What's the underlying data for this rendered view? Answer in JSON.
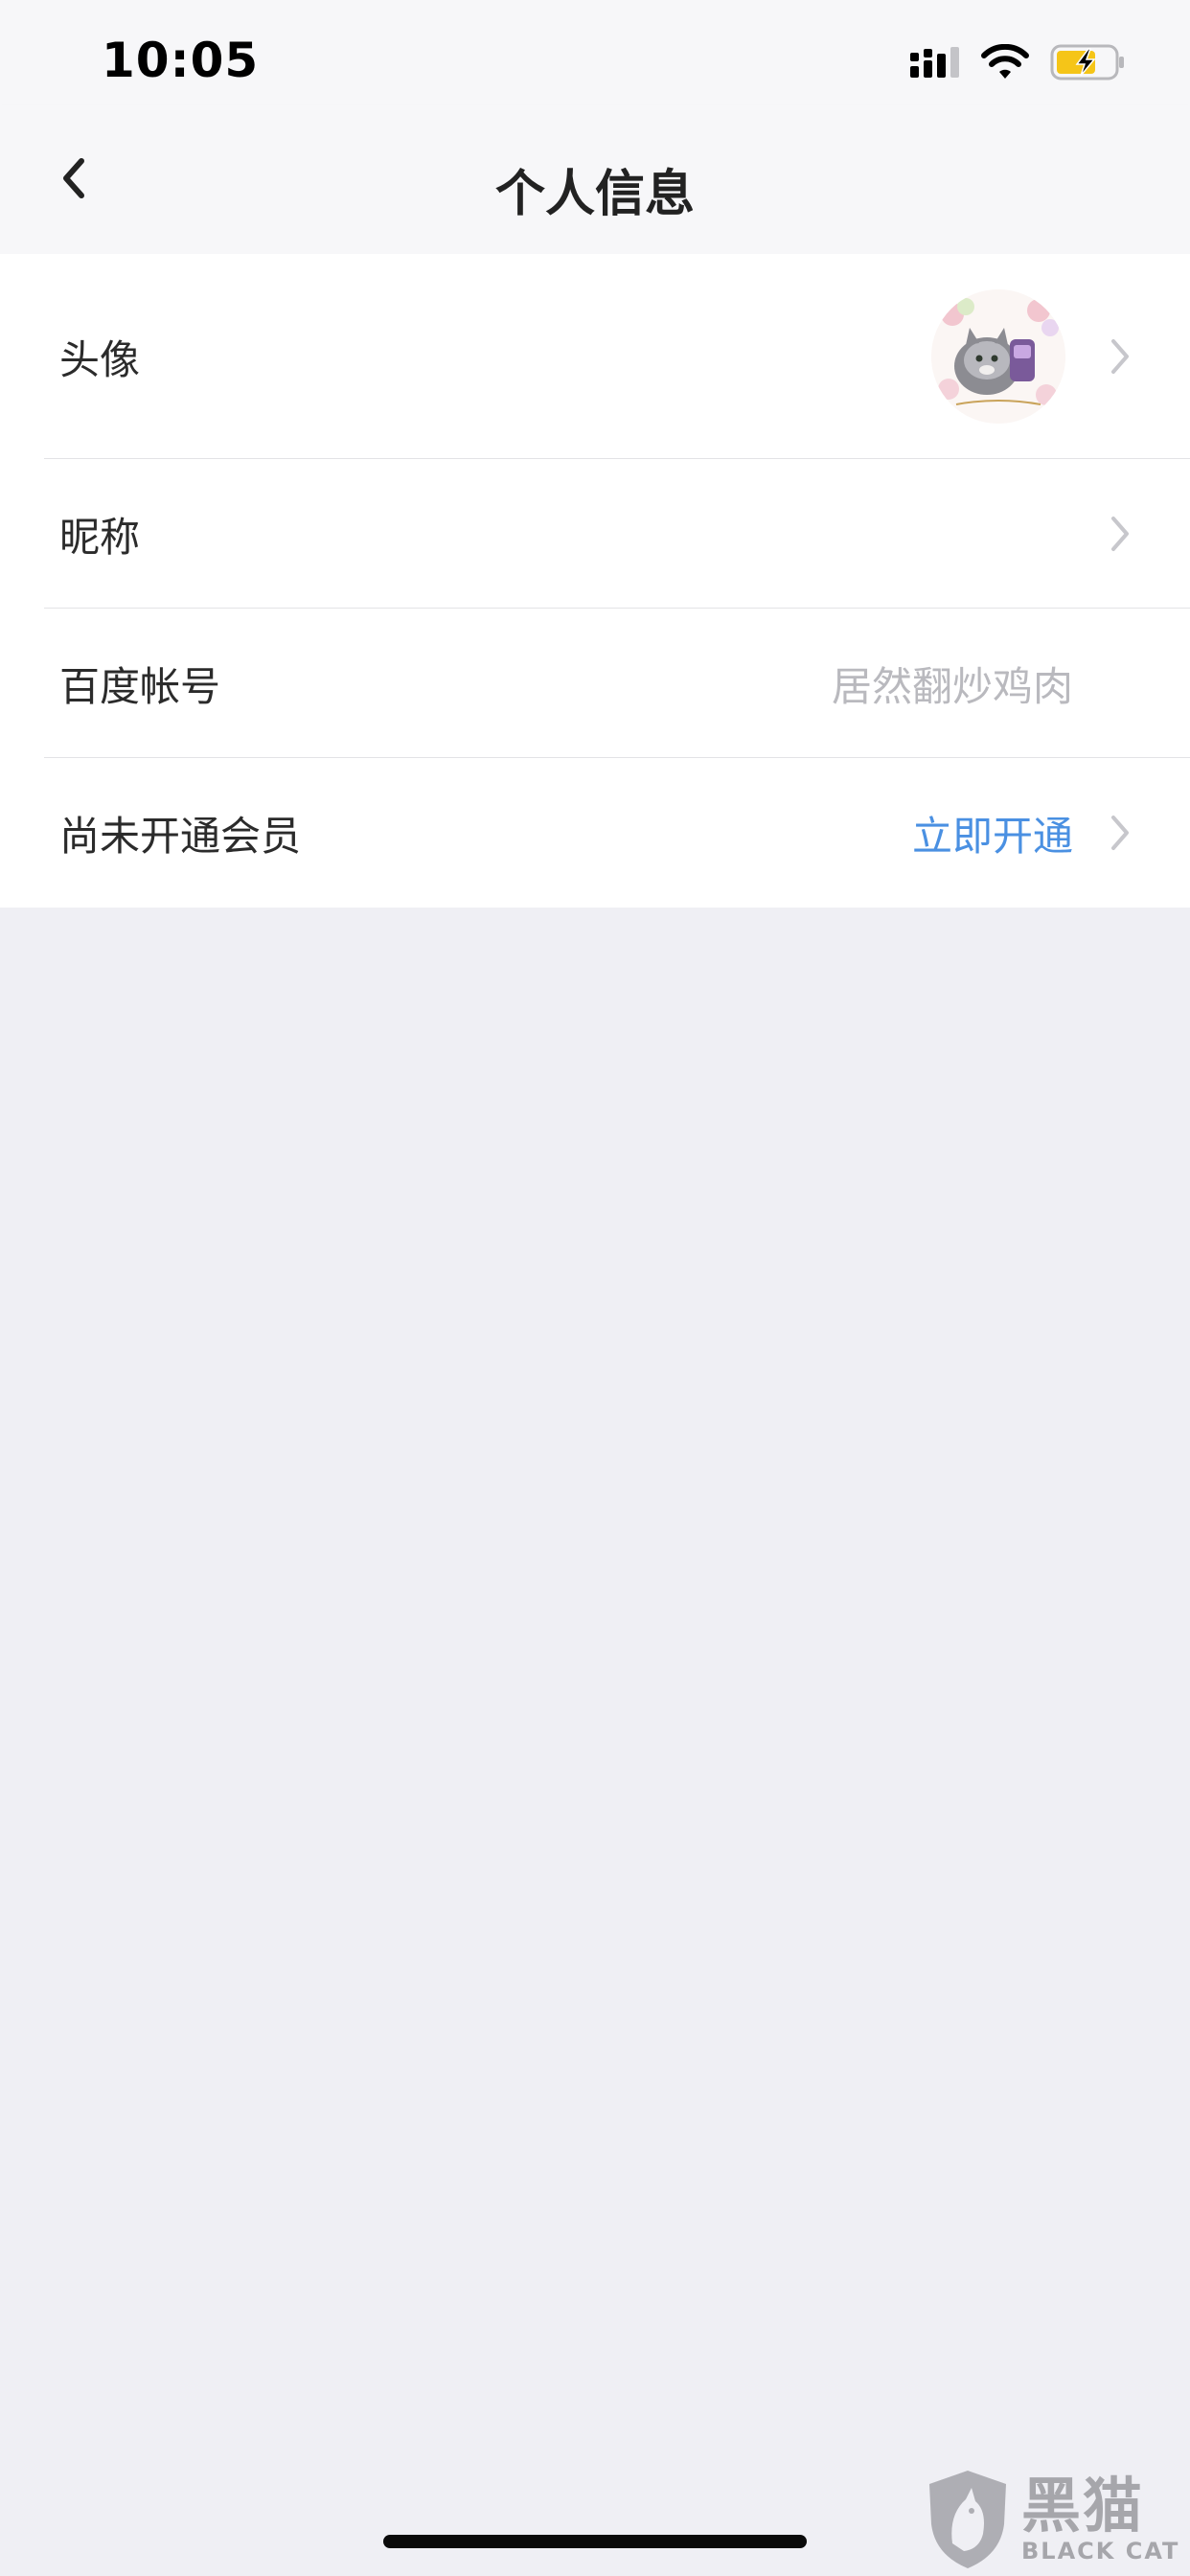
{
  "status_bar": {
    "time": "10:05",
    "icons": [
      "signal-icon",
      "wifi-icon",
      "battery-charging-icon"
    ]
  },
  "nav": {
    "back_icon": "chevron-left-icon",
    "title": "个人信息"
  },
  "rows": [
    {
      "label": "头像",
      "value": "",
      "has_avatar": true,
      "has_chevron": true
    },
    {
      "label": "昵称",
      "value": "",
      "has_chevron": true
    },
    {
      "label": "百度帐号",
      "value": "居然翻炒鸡肉",
      "has_chevron": false
    },
    {
      "label": "尚未开通会员",
      "value": "立即开通",
      "value_is_link": true,
      "has_chevron": true
    }
  ],
  "colors": {
    "page_bg": "#efeff4",
    "card_bg": "#ffffff",
    "link": "#4a90e2",
    "muted": "#b9b9be",
    "battery": "#f5c518"
  },
  "watermark": {
    "cn": "黑猫",
    "en": "BLACK CAT"
  }
}
